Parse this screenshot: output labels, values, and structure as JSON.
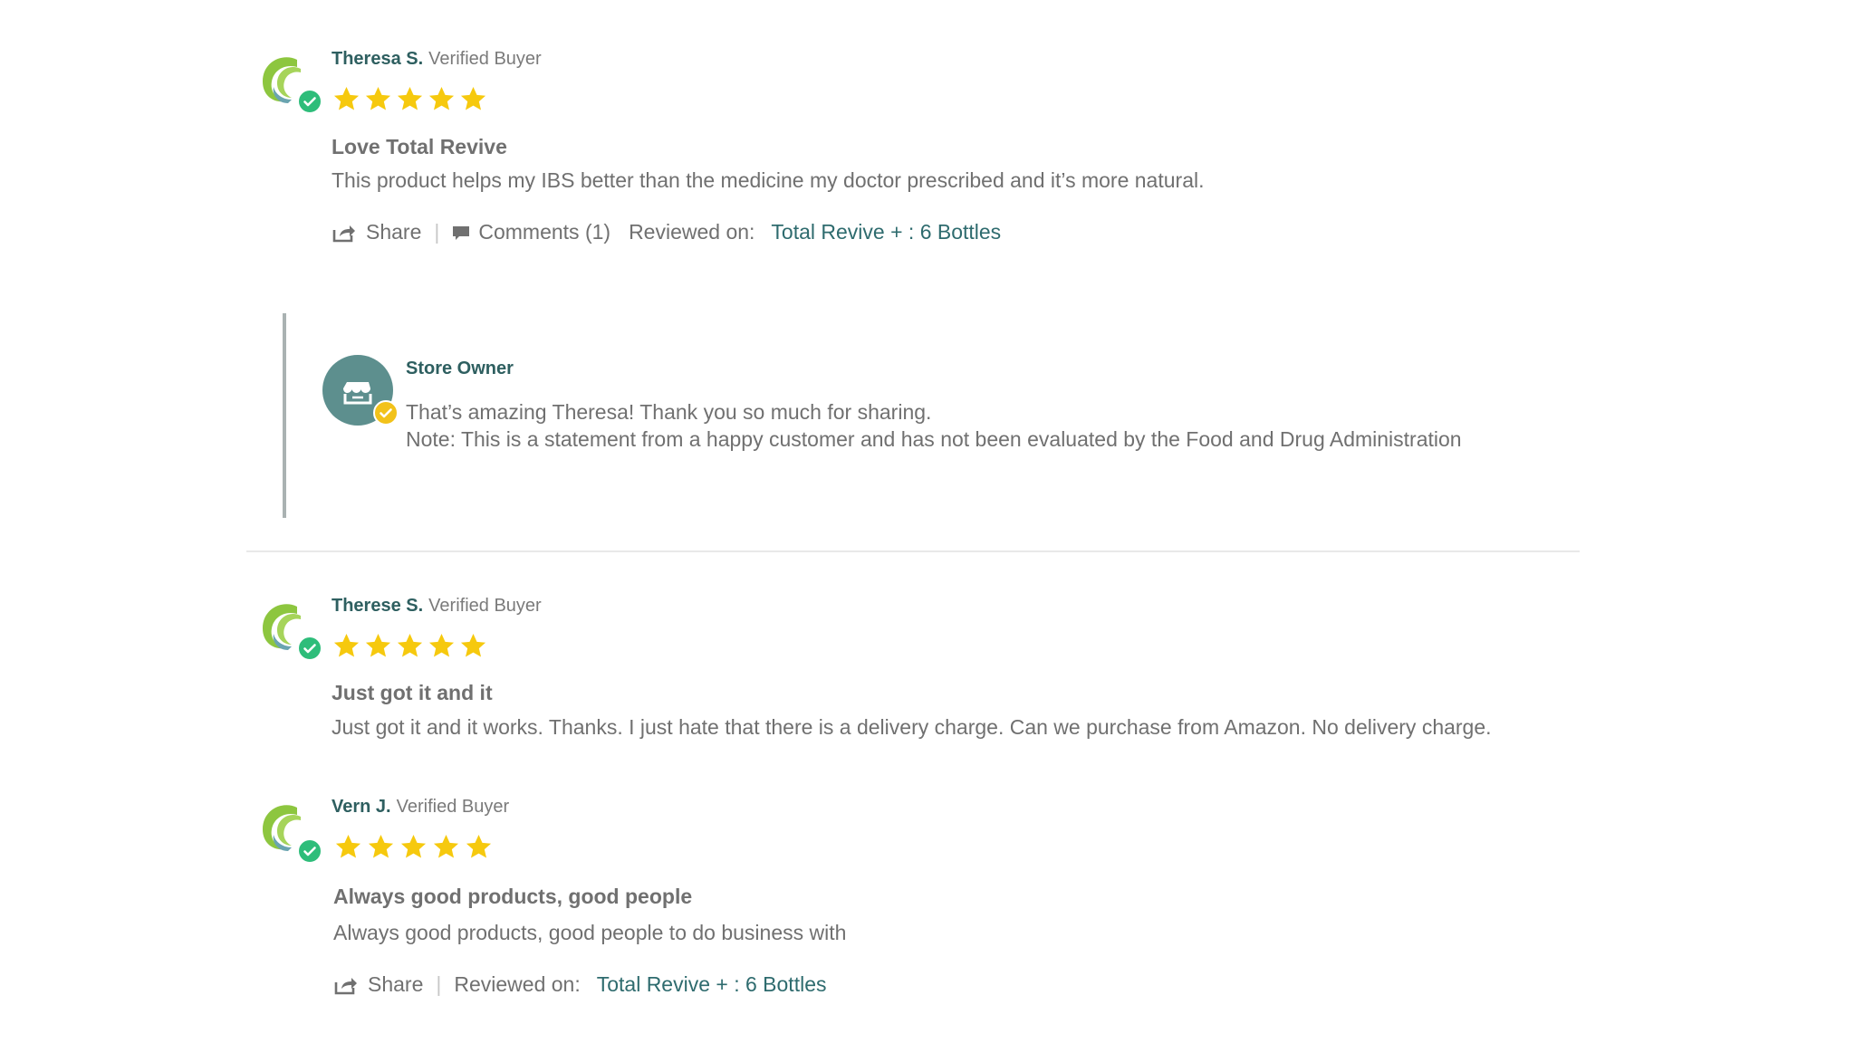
{
  "reviews": [
    {
      "name": "Theresa S.",
      "badge": "Verified Buyer",
      "rating": 5,
      "title": "Love Total Revive",
      "body": "This product helps my IBS better than the medicine my doctor prescribed and it’s more natural.",
      "share_label": "Share",
      "comments_label": "Comments (1)",
      "reviewed_on_label": "Reviewed on:",
      "product_link": "Total Revive + : 6 Bottles"
    },
    {
      "name": "Therese S.",
      "badge": "Verified Buyer",
      "rating": 5,
      "title": "Just got it and it",
      "body": "Just got it and it works. Thanks. I just hate that there is a delivery charge. Can we purchase from Amazon. No delivery charge."
    },
    {
      "name": "Vern J.",
      "badge": "Verified Buyer",
      "rating": 5,
      "title": "Always good products, good people",
      "body": "Always good products, good people to do business with",
      "share_label": "Share",
      "reviewed_on_label": "Reviewed on:",
      "product_link": "Total Revive + : 6 Bottles"
    }
  ],
  "store_reply": {
    "name": "Store Owner",
    "line1": "That’s amazing Theresa! Thank you so much for sharing.",
    "line2": "Note: This is a statement from a happy customer and has not been evaluated by the Food and Drug Administration"
  },
  "icons": {
    "avatar": "green-swirl-logo-icon",
    "verified": "check-circle-icon",
    "star": "star-icon",
    "share": "share-icon",
    "comment": "comment-icon",
    "store": "storefront-icon"
  },
  "colors": {
    "star": "#f6c90e",
    "verified": "#2ebd7a",
    "name": "#2e5f60",
    "link": "#2e6b6e",
    "store_avatar": "#5d8f8e",
    "store_check": "#f2c21a"
  }
}
